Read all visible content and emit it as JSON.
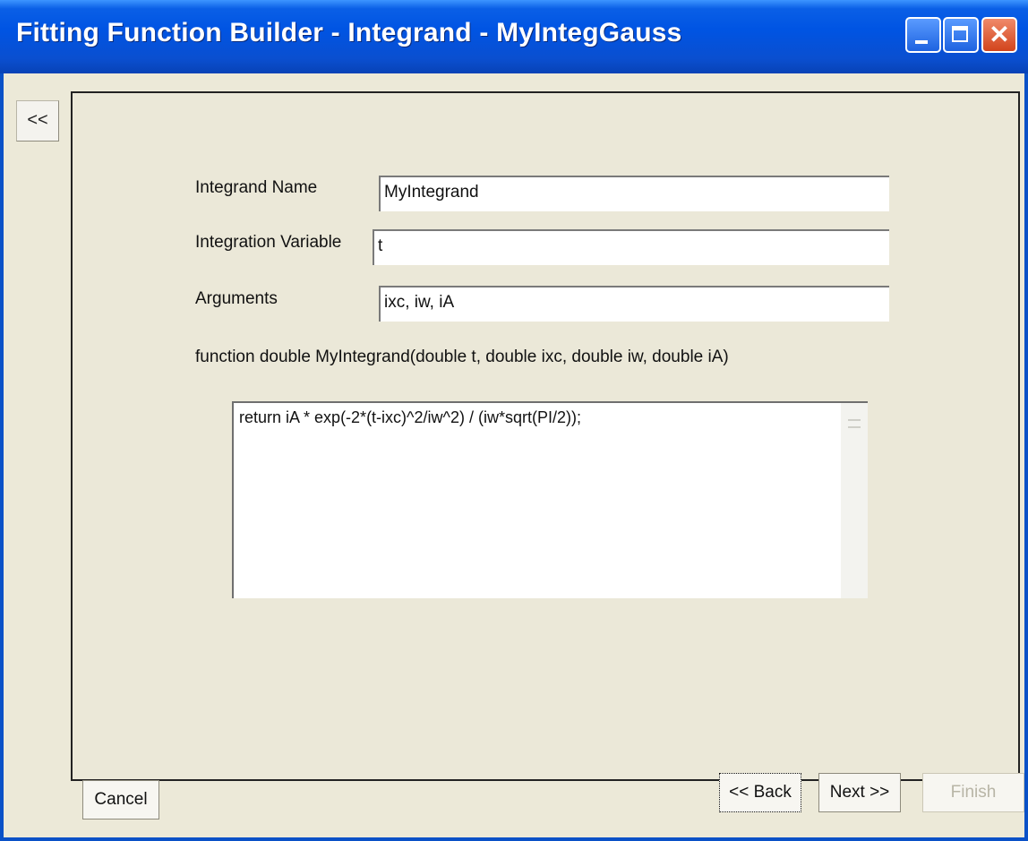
{
  "window": {
    "title": "Fitting Function Builder - Integrand - MyIntegGauss"
  },
  "nav": {
    "collapse_label": "<<"
  },
  "form": {
    "integrand_name_label": "Integrand Name",
    "integrand_name_value": "MyIntegrand",
    "integration_variable_label": "Integration Variable",
    "integration_variable_value": "t",
    "arguments_label": "Arguments",
    "arguments_value": "ixc, iw, iA",
    "signature": "function double MyIntegrand(double t, double ixc, double iw, double iA)",
    "code": "return iA * exp(-2*(t-ixc)^2/iw^2) / (iw*sqrt(PI/2));"
  },
  "buttons": {
    "cancel": "Cancel",
    "back": "<< Back",
    "next": "Next >>",
    "finish": "Finish"
  },
  "icons": {
    "close": "close-icon",
    "minimize": "minimize-icon",
    "maximize": "maximize-icon"
  }
}
